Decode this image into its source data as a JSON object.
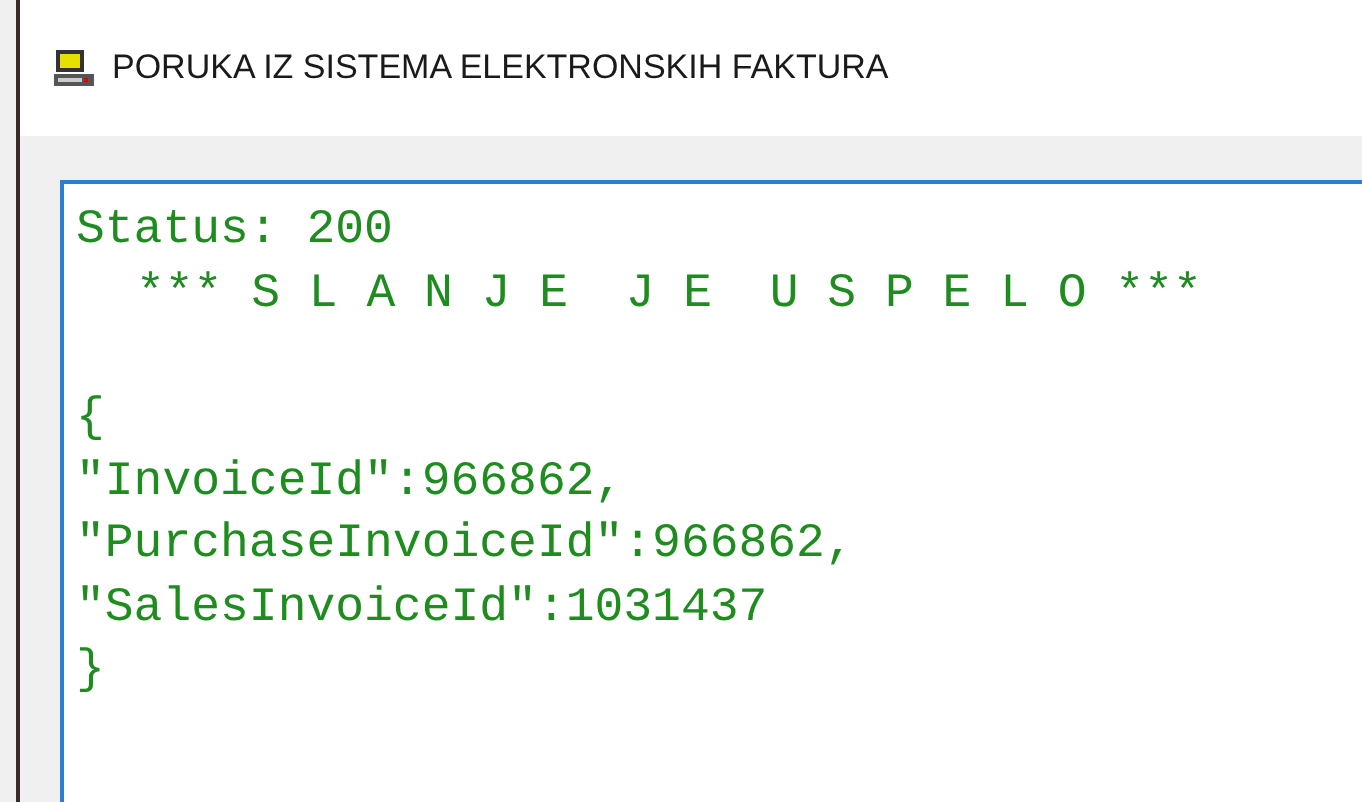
{
  "window": {
    "title": "PORUKA IZ SISTEMA ELEKTRONSKIH FAKTURA"
  },
  "message": {
    "status_line": "Status: 200",
    "banner": "*** S L A N J E  J E  U S P E L O ***",
    "json_lines": [
      "{",
      "\"InvoiceId\":966862,",
      "\"PurchaseInvoiceId\":966862,",
      "\"SalesInvoiceId\":1031437",
      "}"
    ]
  }
}
